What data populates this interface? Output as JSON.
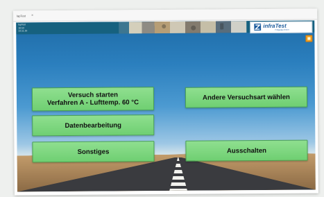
{
  "window": {
    "title": "lapTest",
    "close_glyph": "×"
  },
  "header": {
    "info_lines": [
      "lapTest",
      "10:53",
      "13.11.16"
    ],
    "logo": {
      "name": "infraTest",
      "tagline": "Prüfgeräte GmbH"
    },
    "corner_icon": "settings-icon"
  },
  "buttons": {
    "start": {
      "line1": "Versuch starten",
      "line2": "Verfahren A - Lufttemp. 60 °C"
    },
    "other_test": "Andere Versuchsart wählen",
    "data_processing": "Datenbearbeitung",
    "misc": "Sonstiges",
    "shutdown": "Ausschalten"
  },
  "colors": {
    "button": "#7ed67f",
    "header": "#16617f",
    "sky": "#2b7fbe",
    "logo_blue": "#1b5b9c"
  }
}
